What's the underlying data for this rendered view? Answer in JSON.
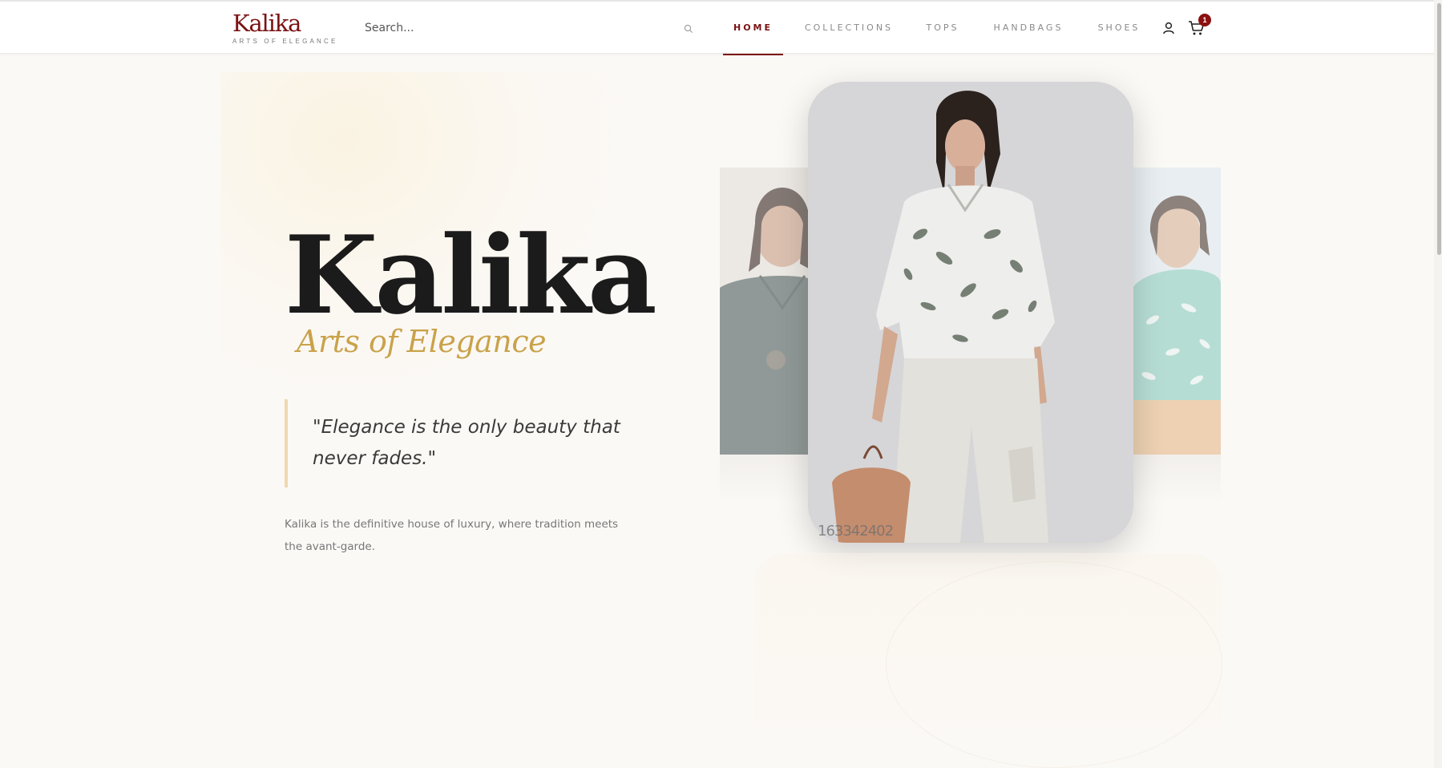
{
  "brand": {
    "name": "Kalika",
    "tagline": "ARTS OF ELEGANCE"
  },
  "search": {
    "placeholder": "Search..."
  },
  "nav": {
    "items": [
      {
        "label": "HOME",
        "active": true
      },
      {
        "label": "COLLECTIONS",
        "active": false
      },
      {
        "label": "TOPS",
        "active": false
      },
      {
        "label": "HANDBAGS",
        "active": false
      },
      {
        "label": "SHOES",
        "active": false
      }
    ]
  },
  "cart": {
    "count": "1"
  },
  "hero": {
    "title": "Kalika",
    "subtitle": "Arts of Elegance",
    "quote": "\"Elegance is the only beauty that never fades.\"",
    "description": "Kalika is the definitive house of luxury, where tradition meets the avant-garde."
  },
  "gallery": {
    "watermark": "163342402"
  },
  "colors": {
    "brand": "#7a1212",
    "accent": "#c9a24a",
    "background": "#fbf9f6",
    "badge": "#8b1010"
  },
  "icons": {
    "search": "search-icon",
    "user": "user-icon",
    "cart": "cart-icon"
  }
}
